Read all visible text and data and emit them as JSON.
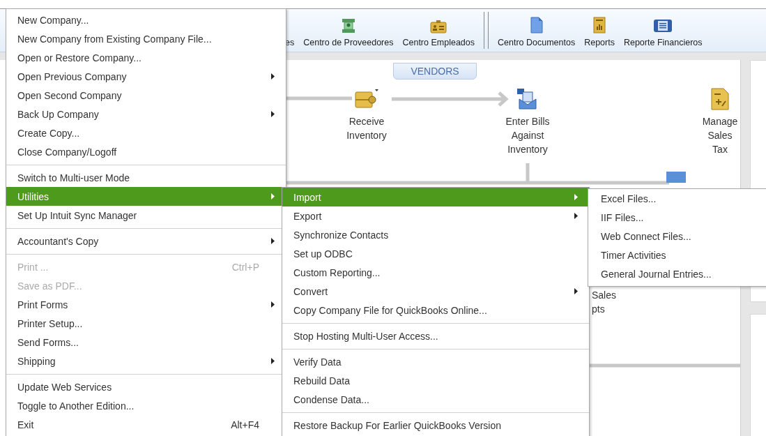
{
  "toolbar": [
    {
      "label": "es"
    },
    {
      "label": "Centro de Proveedores"
    },
    {
      "label": "Centro Empleados"
    },
    {
      "kind": "separator"
    },
    {
      "label": "Centro Documentos"
    },
    {
      "label": "Reports"
    },
    {
      "label": "Reporte Financieros"
    }
  ],
  "home": {
    "tab": "VENDORS",
    "nodes": [
      {
        "label": "Receive Inventory"
      },
      {
        "label": "Enter Bills Against Inventory"
      },
      {
        "label": "Manage Sales Tax"
      }
    ],
    "fragments": [
      "Sales",
      "pts"
    ]
  },
  "file_menu": [
    {
      "kind": "item",
      "label": "New Company...",
      "selected": false,
      "disabled": false,
      "submenu": false
    },
    {
      "kind": "item",
      "label": "New Company from Existing Company File...",
      "selected": false,
      "disabled": false,
      "submenu": false
    },
    {
      "kind": "item",
      "label": "Open or Restore Company...",
      "selected": false,
      "disabled": false,
      "submenu": false
    },
    {
      "kind": "item",
      "label": "Open Previous Company",
      "selected": false,
      "disabled": false,
      "submenu": true
    },
    {
      "kind": "item",
      "label": "Open Second Company",
      "selected": false,
      "disabled": false,
      "submenu": false
    },
    {
      "kind": "item",
      "label": "Back Up Company",
      "selected": false,
      "disabled": false,
      "submenu": true
    },
    {
      "kind": "item",
      "label": "Create Copy...",
      "selected": false,
      "disabled": false,
      "submenu": false
    },
    {
      "kind": "item",
      "label": "Close Company/Logoff",
      "selected": false,
      "disabled": false,
      "submenu": false
    },
    {
      "kind": "separator"
    },
    {
      "kind": "item",
      "label": "Switch to Multi-user Mode",
      "selected": false,
      "disabled": false,
      "submenu": false
    },
    {
      "kind": "item",
      "label": "Utilities",
      "selected": true,
      "disabled": false,
      "submenu": true
    },
    {
      "kind": "item",
      "label": "Set Up Intuit Sync Manager",
      "selected": false,
      "disabled": false,
      "submenu": false
    },
    {
      "kind": "separator"
    },
    {
      "kind": "item",
      "label": "Accountant's Copy",
      "selected": false,
      "disabled": false,
      "submenu": true
    },
    {
      "kind": "separator"
    },
    {
      "kind": "item",
      "label": "Print ...",
      "shortcut": "Ctrl+P",
      "selected": false,
      "disabled": true,
      "submenu": false
    },
    {
      "kind": "item",
      "label": "Save as PDF...",
      "selected": false,
      "disabled": true,
      "submenu": false
    },
    {
      "kind": "item",
      "label": "Print Forms",
      "selected": false,
      "disabled": false,
      "submenu": true
    },
    {
      "kind": "item",
      "label": "Printer Setup...",
      "selected": false,
      "disabled": false,
      "submenu": false
    },
    {
      "kind": "item",
      "label": "Send Forms...",
      "selected": false,
      "disabled": false,
      "submenu": false
    },
    {
      "kind": "item",
      "label": "Shipping",
      "selected": false,
      "disabled": false,
      "submenu": true
    },
    {
      "kind": "separator"
    },
    {
      "kind": "item",
      "label": "Update Web Services",
      "selected": false,
      "disabled": false,
      "submenu": false
    },
    {
      "kind": "item",
      "label": "Toggle to Another Edition...",
      "selected": false,
      "disabled": false,
      "submenu": false
    },
    {
      "kind": "item",
      "label": "Exit",
      "shortcut": "Alt+F4",
      "selected": false,
      "disabled": false,
      "submenu": false
    }
  ],
  "utilities_menu": [
    {
      "kind": "item",
      "label": "Import",
      "selected": true,
      "submenu": true
    },
    {
      "kind": "item",
      "label": "Export",
      "selected": false,
      "submenu": true
    },
    {
      "kind": "item",
      "label": "Synchronize Contacts",
      "selected": false,
      "submenu": false
    },
    {
      "kind": "item",
      "label": "Set up ODBC",
      "selected": false,
      "submenu": false
    },
    {
      "kind": "item",
      "label": "Custom Reporting...",
      "selected": false,
      "submenu": false
    },
    {
      "kind": "item",
      "label": "Convert",
      "selected": false,
      "submenu": true
    },
    {
      "kind": "item",
      "label": "Copy Company File for QuickBooks Online...",
      "selected": false,
      "submenu": false
    },
    {
      "kind": "separator"
    },
    {
      "kind": "item",
      "label": "Stop Hosting Multi-User Access...",
      "selected": false,
      "submenu": false
    },
    {
      "kind": "separator"
    },
    {
      "kind": "item",
      "label": "Verify Data",
      "selected": false,
      "submenu": false
    },
    {
      "kind": "item",
      "label": "Rebuild Data",
      "selected": false,
      "submenu": false
    },
    {
      "kind": "item",
      "label": "Condense Data...",
      "selected": false,
      "submenu": false
    },
    {
      "kind": "separator"
    },
    {
      "kind": "item",
      "label": "Restore Backup For Earlier QuickBooks Version",
      "selected": false,
      "submenu": false
    }
  ],
  "import_menu": [
    {
      "kind": "item",
      "label": "Excel Files...",
      "selected": false
    },
    {
      "kind": "item",
      "label": "IIF Files...",
      "selected": false
    },
    {
      "kind": "item",
      "label": "Web Connect Files...",
      "selected": false
    },
    {
      "kind": "item",
      "label": "Timer Activities",
      "selected": false
    },
    {
      "kind": "item",
      "label": "General Journal Entries...",
      "selected": false
    }
  ]
}
